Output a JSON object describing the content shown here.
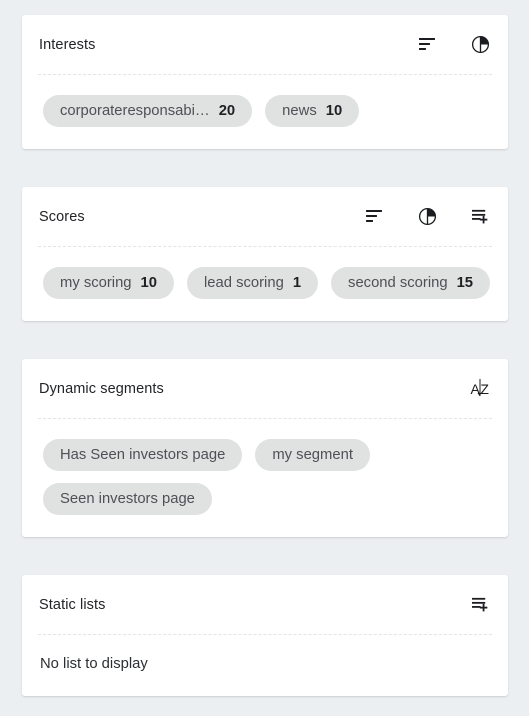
{
  "theme": {
    "page_background": "#eceff1",
    "card_background": "#ffffff",
    "chip_background": "#e0e1e1",
    "text_color": "#222428",
    "chip_text_color": "#4d5156",
    "divider_color": "#e2e4e6"
  },
  "cards": [
    {
      "title": "Interests",
      "actions": [
        {
          "icon": "sort-icon",
          "name": "sort-interests-button"
        },
        {
          "icon": "pie-chart-icon",
          "name": "chart-interests-button"
        }
      ],
      "chips": [
        {
          "label": "corporateresponsabi…",
          "value": "20",
          "truncated": true
        },
        {
          "label": "news",
          "value": "10",
          "truncated": false
        }
      ],
      "empty_text": ""
    },
    {
      "title": "Scores",
      "actions": [
        {
          "icon": "sort-icon",
          "name": "sort-scores-button"
        },
        {
          "icon": "pie-chart-icon",
          "name": "chart-scores-button"
        },
        {
          "icon": "list-plus-icon",
          "name": "add-score-button"
        }
      ],
      "chips": [
        {
          "label": "my scoring",
          "value": "10",
          "truncated": false
        },
        {
          "label": "lead scoring",
          "value": "1",
          "truncated": false
        },
        {
          "label": "second scoring",
          "value": "15",
          "truncated": false
        }
      ],
      "empty_text": ""
    },
    {
      "title": "Dynamic segments",
      "actions": [
        {
          "icon": "sort-alpha-icon",
          "name": "sort-segments-alpha-button",
          "glyph_a": "A",
          "glyph_z": "Z"
        }
      ],
      "chips": [
        {
          "label": "Has Seen investors page",
          "value": "",
          "truncated": false
        },
        {
          "label": "my segment",
          "value": "",
          "truncated": false
        },
        {
          "label": "Seen investors page",
          "value": "",
          "truncated": false
        }
      ],
      "empty_text": ""
    },
    {
      "title": "Static lists",
      "actions": [
        {
          "icon": "list-plus-icon",
          "name": "add-static-list-button"
        }
      ],
      "chips": [],
      "empty_text": "No list to display"
    }
  ]
}
